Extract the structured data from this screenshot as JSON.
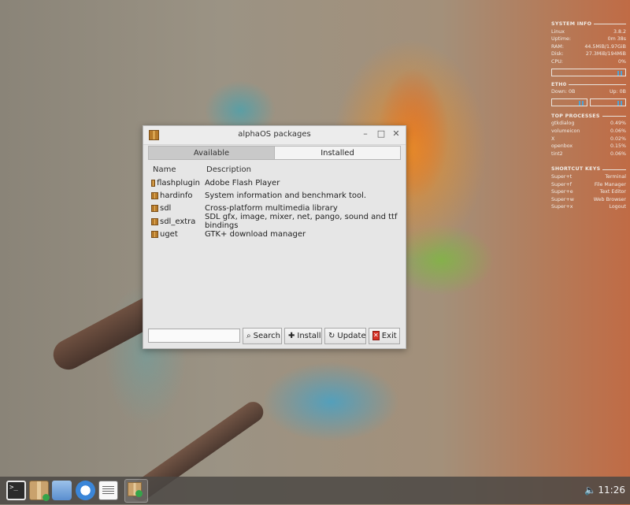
{
  "conky": {
    "system_info": {
      "header": "SYSTEM INFO",
      "rows": [
        {
          "label": "Linux",
          "value": "3.8.2"
        },
        {
          "label": "Uptime:",
          "value": "0m 38s"
        },
        {
          "label": "RAM:",
          "value": "44.5MiB/1.97GiB"
        },
        {
          "label": "Disk:",
          "value": "27.3MiB/194MiB"
        },
        {
          "label": "CPU:",
          "value": "0%"
        }
      ]
    },
    "network": {
      "header": "ETH0",
      "down": "Down: 0B",
      "up": "Up: 0B"
    },
    "top_processes": {
      "header": "TOP PROCESSES",
      "rows": [
        {
          "label": "gtkdialog",
          "value": "0.49%"
        },
        {
          "label": "volumeicon",
          "value": "0.06%"
        },
        {
          "label": "X",
          "value": "0.02%"
        },
        {
          "label": "openbox",
          "value": "0.15%"
        },
        {
          "label": "tint2",
          "value": "0.06%"
        }
      ]
    },
    "shortcut_keys": {
      "header": "SHORTCUT KEYS",
      "rows": [
        {
          "label": "Super+t",
          "value": "Terminal"
        },
        {
          "label": "Super+f",
          "value": "File Manager"
        },
        {
          "label": "Super+e",
          "value": "Text Editor"
        },
        {
          "label": "Super+w",
          "value": "Web Browser"
        },
        {
          "label": "Super+x",
          "value": "Logout"
        }
      ]
    }
  },
  "window": {
    "title": "alphaOS packages",
    "controls": {
      "minimize": "–",
      "maximize": "□",
      "close": "✕"
    },
    "tabs": [
      {
        "label": "Available",
        "active": true
      },
      {
        "label": "Installed",
        "active": false
      }
    ],
    "columns": {
      "name": "Name",
      "description": "Description"
    },
    "packages": [
      {
        "name": "flashplugin",
        "description": "Adobe Flash Player"
      },
      {
        "name": "hardinfo",
        "description": "System information and benchmark tool."
      },
      {
        "name": "sdl",
        "description": "Cross-platform multimedia library"
      },
      {
        "name": "sdl_extra",
        "description": "SDL gfx, image, mixer, net, pango, sound and ttf bindings"
      },
      {
        "name": "uget",
        "description": "GTK+ download manager"
      }
    ],
    "search": {
      "value": "",
      "placeholder": ""
    },
    "buttons": {
      "search": "Search",
      "install": "Install",
      "update": "Update",
      "exit": "Exit"
    }
  },
  "taskbar": {
    "launchers": [
      "terminal-icon",
      "package-manager-icon",
      "file-manager-icon",
      "web-browser-icon",
      "text-editor-icon"
    ],
    "active_task": "alphaOS packages",
    "clock": "11:26"
  }
}
